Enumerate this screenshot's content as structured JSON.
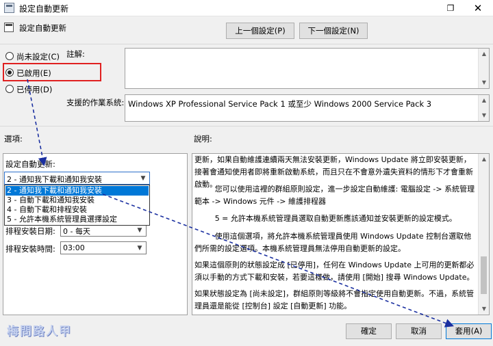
{
  "window": {
    "title": "設定自動更新",
    "restore_glyph": "❐",
    "close_glyph": "✕"
  },
  "header": {
    "title": "設定自動更新",
    "prev_label": "上一個設定(P)",
    "next_label": "下一個設定(N)"
  },
  "state": {
    "options": [
      {
        "label": "尚未設定(C)",
        "selected": false
      },
      {
        "label": "已啟用(E)",
        "selected": true
      },
      {
        "label": "已停用(D)",
        "selected": false
      }
    ]
  },
  "comment": {
    "label": "註解:"
  },
  "supported": {
    "label": "支援的作業系統:",
    "value": "Windows XP Professional Service Pack 1 或至少 Windows 2000 Service Pack 3"
  },
  "options_panel": {
    "heading": "選項:",
    "configure_label": "設定自動更新:",
    "configure_value": "2 - 通知我下載和通知我安裝",
    "dropdown_items": [
      "2 - 通知我下載和通知我安裝",
      "3 - 自動下載和通知我安裝",
      "4 - 自動下載和排程安裝",
      "5 - 允許本機系統管理員選擇設定"
    ],
    "day_label": "排程安裝日期:",
    "day_value": "0 - 每天",
    "time_label": "排程安裝時間:",
    "time_value": "03:00"
  },
  "explanation": {
    "heading": "說明:",
    "paragraphs": [
      "更新，如果自動維護連續兩天無法安裝更新，Windows Update 將立即安裝更新，接著會通知使用者即將重新啟動系統，而且只在不會意外遺失資料的情形下才會重新啟動。",
      "您可以使用這裡的群組原則設定，進一步設定自動維護: 電腦設定 -> 系統管理範本 -> Windows 元件 -> 維護排程器",
      "5 = 允許本機系統管理員選取自動更新應該通知並安裝更新的設定模式。",
      "使用這個選項，將允許本機系統管理員使用 Windows Update 控制台選取他們所需的設定選項。本機系統管理員無法停用自動更新的設定。",
      "如果這個原則的狀態設定成 [已停用]，任何在 Windows Update 上可用的更新都必須以手動的方式下載和安裝，若要這樣做，請使用 [開始] 搜尋 Windows Update。",
      "如果狀態設定為 [尚未設定]，群組原則等級將不會指定使用自動更新。不過，系統管理員還是能從 [控制台] 設定 [自動更新] 功能。"
    ]
  },
  "buttons": {
    "ok": "確定",
    "cancel": "取消",
    "apply": "套用(A)"
  },
  "watermark": "梅問路人甲",
  "colors": {
    "highlight_box": "#e02020",
    "arrow": "#1a2fa0",
    "selection": "#0078d7"
  }
}
